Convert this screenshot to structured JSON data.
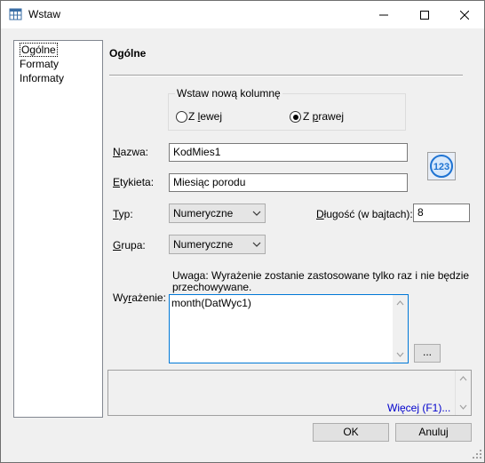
{
  "window": {
    "title": "Wstaw",
    "icons": {
      "app": "table-icon",
      "minimize": "minimize-icon",
      "maximize": "maximize-icon",
      "close": "close-icon"
    }
  },
  "nav": {
    "items": [
      {
        "label": "Ogólne",
        "selected": true
      },
      {
        "label": "Formaty",
        "selected": false
      },
      {
        "label": "Informaty",
        "selected": false
      }
    ]
  },
  "panel": {
    "title": "Ogólne",
    "insert_group": {
      "legend": "Wstaw nową kolumnę",
      "left": {
        "label_prefix": "Z ",
        "label_accel": "l",
        "label_rest": "ewej",
        "checked": false
      },
      "right": {
        "label_prefix": "Z ",
        "label_accel": "p",
        "label_rest": "rawej",
        "checked": true
      }
    },
    "name": {
      "label_accel": "N",
      "label_rest": "azwa:",
      "value": "KodMies1"
    },
    "label_field": {
      "label_accel": "E",
      "label_rest": "tykieta:",
      "value": "Miesiąc porodu"
    },
    "type": {
      "label_accel": "T",
      "label_rest": "yp:",
      "value": "Numeryczne"
    },
    "length": {
      "label_accel": "D",
      "label_rest": "ługość (w bajtach):",
      "value": "8"
    },
    "group": {
      "label_accel": "G",
      "label_rest": "rupa:",
      "value": "Numeryczne"
    },
    "expression": {
      "note_line1": "Uwaga: Wyrażenie zostanie zastosowane tylko raz i nie będzie",
      "note_line2": "przechowywane.",
      "label_prefix": "Wy",
      "label_accel": "r",
      "label_rest": "ażenie:",
      "value": "month(DatWyc1)",
      "browse_label": "..."
    },
    "numeric_icon": "numeric-123-icon",
    "info": {
      "more_label": "Więcej (F1)..."
    }
  },
  "buttons": {
    "ok": "OK",
    "cancel": "Anuluj"
  },
  "colors": {
    "link": "#0000cc",
    "focus_border": "#0078d7",
    "icon_blue": "#1e73d2"
  }
}
